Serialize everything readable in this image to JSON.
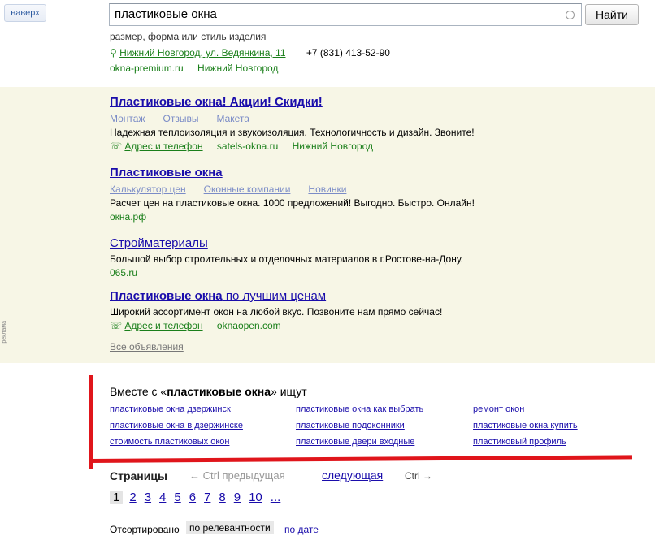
{
  "header": {
    "back_label": "наверх",
    "search_value": "пластиковые окна",
    "find_label": "Найти"
  },
  "prev_result": {
    "text_line": "размер, форма или стиль изделия",
    "address": "Нижний Новгород, ул. Ведянкина, 11",
    "phone": "+7 (831) 413-52-90",
    "domain": "okna-premium.ru",
    "region": "Нижний Новгород"
  },
  "ads": {
    "items": [
      {
        "title_bold": "Пластиковые окна! Акции! Скидки!",
        "title_plain": "",
        "sitelinks": [
          "Монтаж",
          "Отзывы",
          "Макета"
        ],
        "text": "Надежная теплоизоляция и звукоизоляция. Технологичность и дизайн. Звоните!",
        "contact": "Адрес и телефон",
        "domain": "satels-okna.ru",
        "region": "Нижний Новгород"
      },
      {
        "title_bold": "Пластиковые окна",
        "title_plain": "",
        "sitelinks": [
          "Калькулятор цен",
          "Оконные компании",
          "Новинки"
        ],
        "text": "Расчет цен на пластиковые окна. 1000 предложений! Выгодно. Быстро. Онлайн!",
        "contact": "",
        "domain": "окна.рф",
        "region": ""
      },
      {
        "title_bold": "",
        "title_plain": "Стройматериалы",
        "sitelinks": [],
        "text": "Большой выбор строительных и отделочных материалов в г.Ростове-на-Дону.",
        "contact": "",
        "domain": "065.ru",
        "region": ""
      },
      {
        "title_bold": "Пластиковые окна",
        "title_plain": " по лучшим ценам",
        "sitelinks": [],
        "text": "Широкий ассортимент окон на любой вкус. Позвоните нам прямо сейчас!",
        "contact": "Адрес и телефон",
        "domain": "oknaopen.com",
        "region": ""
      }
    ],
    "all_ads": "Все объявления",
    "side_label": "реклама"
  },
  "related": {
    "heading_pre": "Вместе с «",
    "heading_bold": "пластиковые окна",
    "heading_post": "» ищут",
    "columns": [
      [
        "пластиковые окна дзержинск",
        "пластиковые окна в дзержинске",
        "стоимость пластиковых окон"
      ],
      [
        "пластиковые окна как выбрать",
        "пластиковые подоконники",
        "пластиковые двери входные"
      ],
      [
        "ремонт окон",
        "пластиковые окна купить",
        "пластиковый профиль"
      ]
    ]
  },
  "pager": {
    "label": "Страницы",
    "prev": "← Ctrl  предыдущая",
    "next": "следующая",
    "next_key": "Ctrl →",
    "pages": [
      "1",
      "2",
      "3",
      "4",
      "5",
      "6",
      "7",
      "8",
      "9",
      "10",
      "..."
    ],
    "current": "1"
  },
  "sort": {
    "label": "Отсортировано",
    "current": "по релевантности",
    "alt": "по дате"
  },
  "colors": {
    "link": "#1a0dab",
    "ad_background": "#f7f6e6",
    "url_green": "#1a7f1a",
    "highlight_red": "#e0151b"
  }
}
